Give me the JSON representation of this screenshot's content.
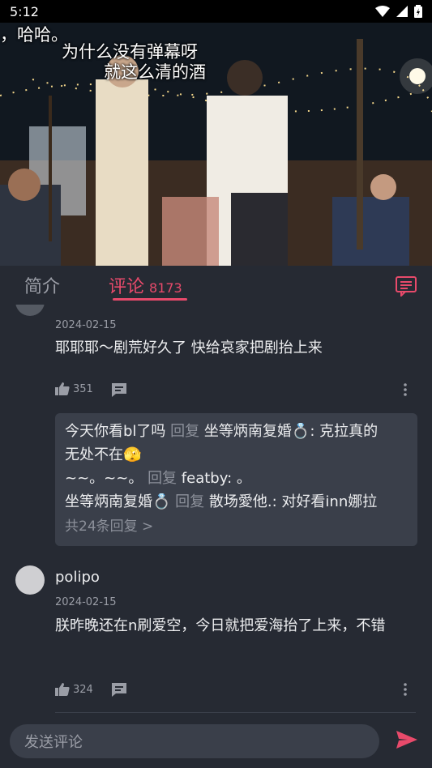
{
  "status_bar": {
    "time": "5:12"
  },
  "video": {
    "subtitle_edge": "，哈哈。",
    "subtitle_line1": "为什么没有弹幕呀",
    "subtitle_line2": "就这么清的酒"
  },
  "tabs": {
    "intro_label": "简介",
    "comments_label": "评论",
    "comments_count": "8173"
  },
  "comments": [
    {
      "date": "2024-02-15",
      "text": "耶耶耶～剧荒好久了 快给哀家把剧抬上来  ",
      "likes": "351",
      "replies": [
        {
          "name": "今天你看bl了吗",
          "reply_word": "回复",
          "target": "坐等炳南复婚💍:",
          "text": "克拉真的"
        },
        {
          "name": "",
          "reply_word": "",
          "target": "",
          "text": "无处不在🫣"
        },
        {
          "name": "~~。~~。",
          "reply_word": "回复",
          "target": "featby:",
          "text": "。"
        },
        {
          "name": "坐等炳南复婚💍",
          "reply_word": "回复",
          "target": "散场愛他.:",
          "text": "对好看inn娜拉"
        }
      ],
      "more_replies": "共24条回复 >"
    },
    {
      "username": "polipo",
      "date": "2024-02-15",
      "text": "朕昨晚还在n刷爱空，今日就把爱海抬了上来，不错",
      "likes": "324"
    }
  ],
  "composer": {
    "placeholder": "发送评论"
  },
  "colors": {
    "accent": "#e84a6b",
    "background": "#262a33",
    "reply_box": "#3a3f4a"
  }
}
